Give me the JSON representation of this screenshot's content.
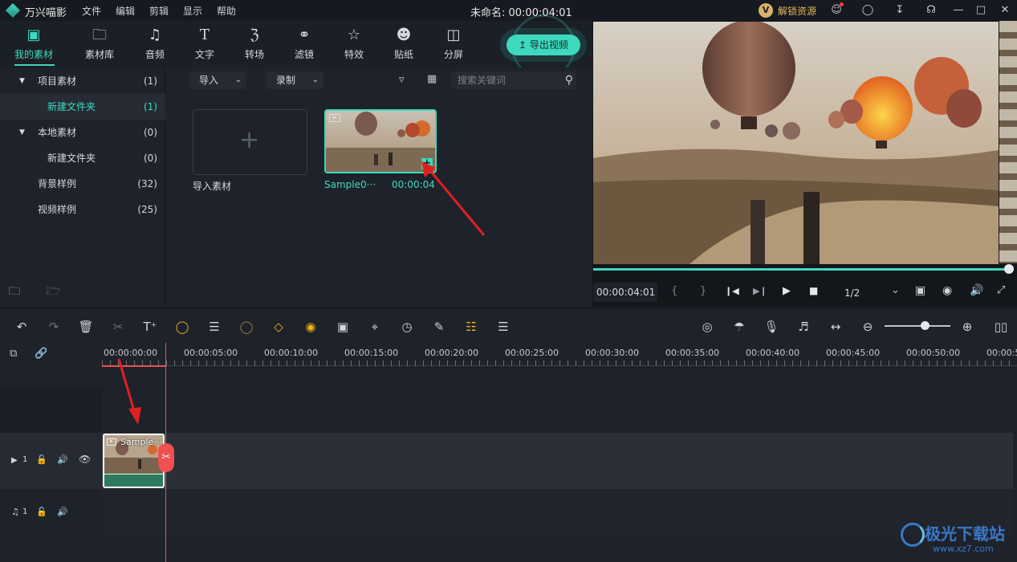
{
  "app": {
    "name": "万兴喵影",
    "project_title": "未命名: 00:00:04:01",
    "unlock_label": "解锁资源"
  },
  "menu": [
    "文件",
    "编辑",
    "剪辑",
    "显示",
    "帮助"
  ],
  "toolbar": {
    "tabs": [
      {
        "label": "我的素材",
        "icon": "folder-box-icon"
      },
      {
        "label": "素材库",
        "icon": "folder-icon"
      },
      {
        "label": "音频",
        "icon": "music-note-icon"
      },
      {
        "label": "文字",
        "icon": "text-icon"
      },
      {
        "label": "转场",
        "icon": "transition-icon"
      },
      {
        "label": "滤镜",
        "icon": "filter-icon"
      },
      {
        "label": "特效",
        "icon": "effects-star-icon"
      },
      {
        "label": "贴纸",
        "icon": "sticker-icon"
      },
      {
        "label": "分屏",
        "icon": "split-screen-icon"
      }
    ],
    "active_tab": "我的素材",
    "export_label": "导出视频"
  },
  "left_panel": {
    "items": [
      {
        "label": "项目素材",
        "count": "(1)"
      },
      {
        "label": "新建文件夹",
        "count": "(1)"
      },
      {
        "label": "本地素材",
        "count": "(0)"
      },
      {
        "label": "新建文件夹",
        "count": "(0)"
      },
      {
        "label": "背景样例",
        "count": "(32)"
      },
      {
        "label": "视频样例",
        "count": "(25)"
      }
    ]
  },
  "media_panel": {
    "import_label": "导入",
    "record_label": "录制",
    "search_placeholder": "搜索关键词",
    "import_tile_label": "导入素材",
    "clip": {
      "name": "Sample0···",
      "duration": "00:00:04"
    }
  },
  "preview": {
    "timecode": "00:00:04:01",
    "ratio": "1/2",
    "progress_fraction": 1.0
  },
  "timeline": {
    "ticks": [
      "00:00:00:00",
      "00:00:05:00",
      "00:00:10:00",
      "00:00:15:00",
      "00:00:20:00",
      "00:00:25:00",
      "00:00:30:00",
      "00:00:35:00",
      "00:00:40:00",
      "00:00:45:00",
      "00:00:50:00",
      "00:00:5"
    ],
    "video_track_label": "1",
    "audio_track_label": "1",
    "clip_label": "Sample···"
  },
  "watermark": {
    "site": "极光下载站",
    "url": "www.xz7.com"
  },
  "colors": {
    "accent": "#3ed8bf",
    "playhead": "#f05050",
    "gold": "#f0b21a",
    "arrow": "#e02020"
  }
}
